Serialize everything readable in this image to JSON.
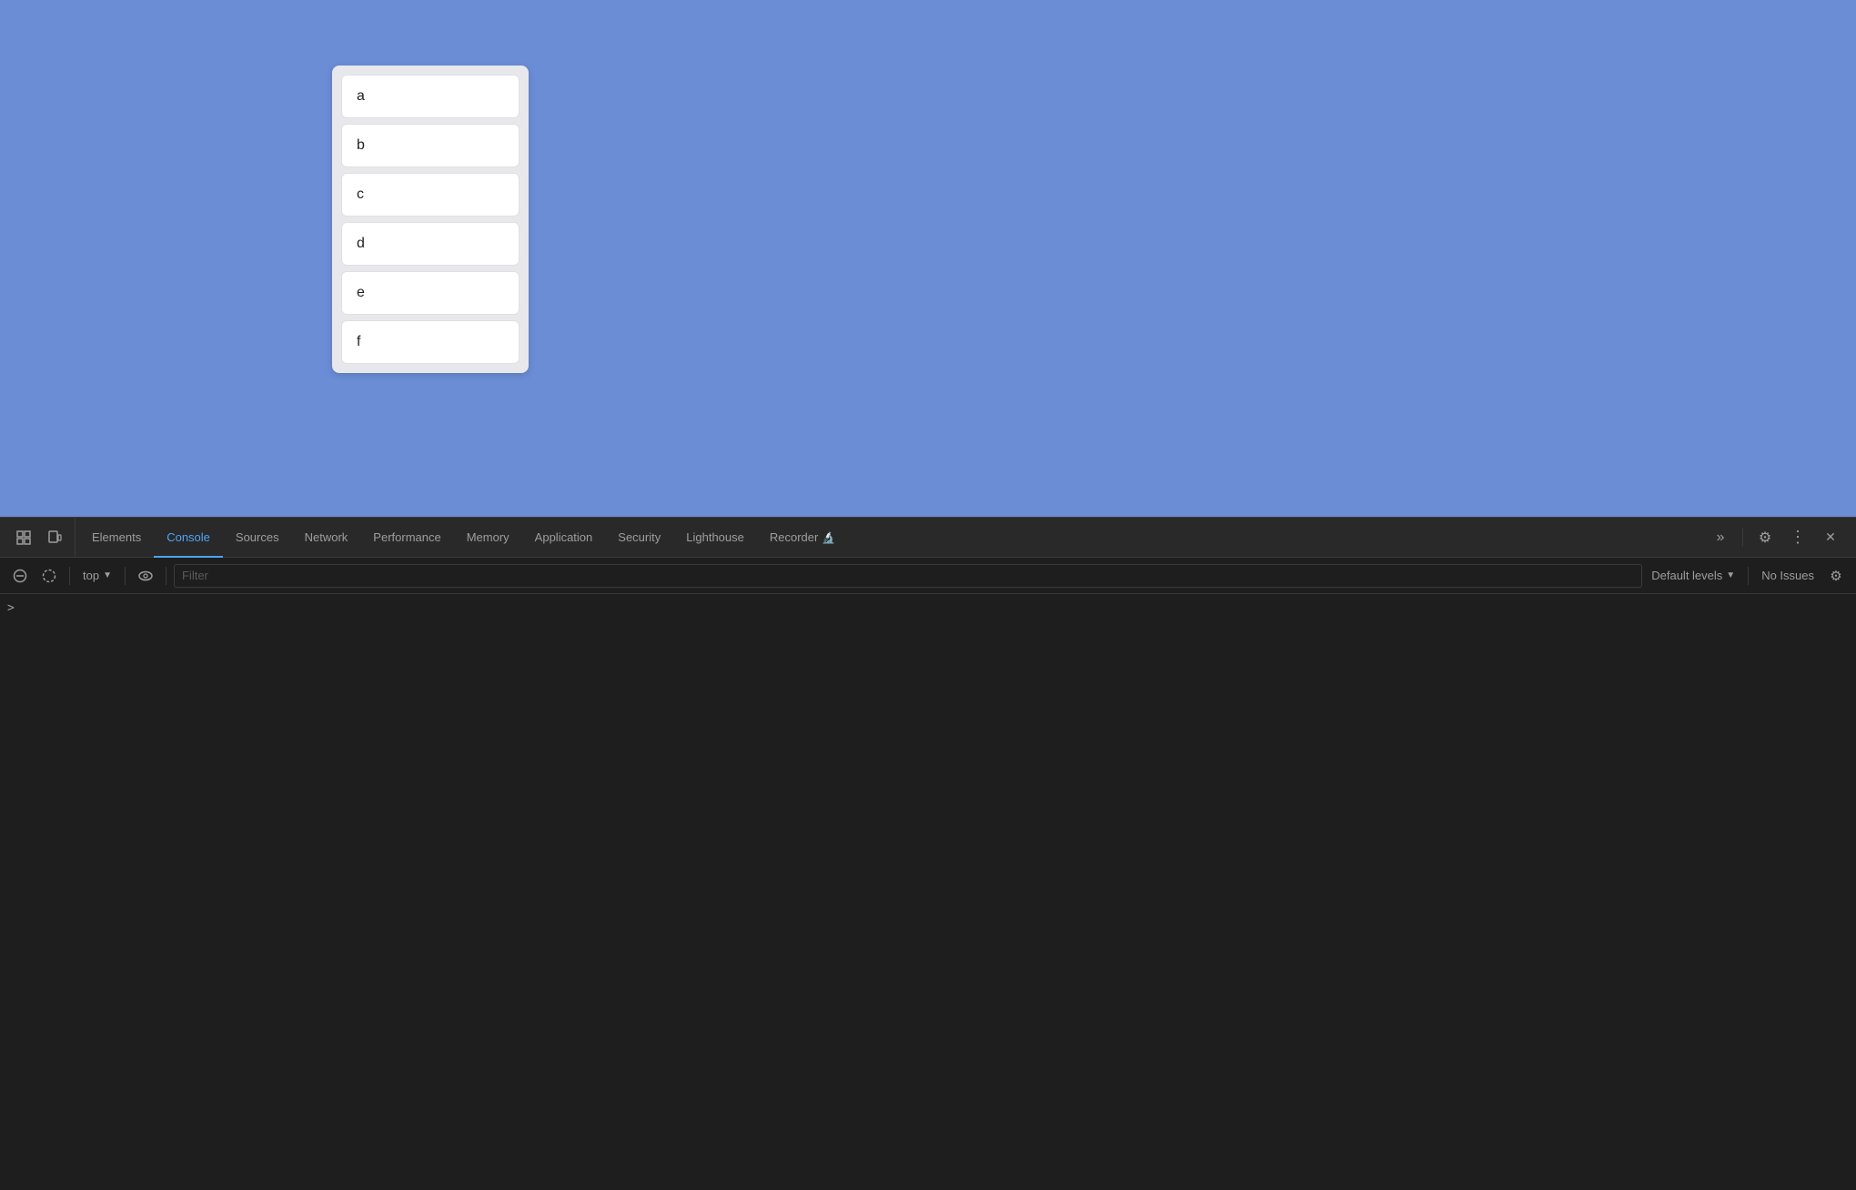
{
  "browser": {
    "background_color": "#6b8dd6"
  },
  "card": {
    "items": [
      {
        "label": "a"
      },
      {
        "label": "b"
      },
      {
        "label": "c"
      },
      {
        "label": "d"
      },
      {
        "label": "e"
      },
      {
        "label": "f"
      }
    ]
  },
  "devtools": {
    "tabs": [
      {
        "id": "elements",
        "label": "Elements",
        "active": false
      },
      {
        "id": "console",
        "label": "Console",
        "active": true
      },
      {
        "id": "sources",
        "label": "Sources",
        "active": false
      },
      {
        "id": "network",
        "label": "Network",
        "active": false
      },
      {
        "id": "performance",
        "label": "Performance",
        "active": false
      },
      {
        "id": "memory",
        "label": "Memory",
        "active": false
      },
      {
        "id": "application",
        "label": "Application",
        "active": false
      },
      {
        "id": "security",
        "label": "Security",
        "active": false
      },
      {
        "id": "lighthouse",
        "label": "Lighthouse",
        "active": false
      },
      {
        "id": "recorder",
        "label": "Recorder",
        "active": false
      }
    ],
    "toolbar": {
      "context_label": "top",
      "filter_placeholder": "Filter",
      "default_levels_label": "Default levels",
      "no_issues_label": "No Issues",
      "settings_icon": "⚙",
      "more_icon": "⋮",
      "close_icon": "✕"
    },
    "console_prompt": ">"
  }
}
